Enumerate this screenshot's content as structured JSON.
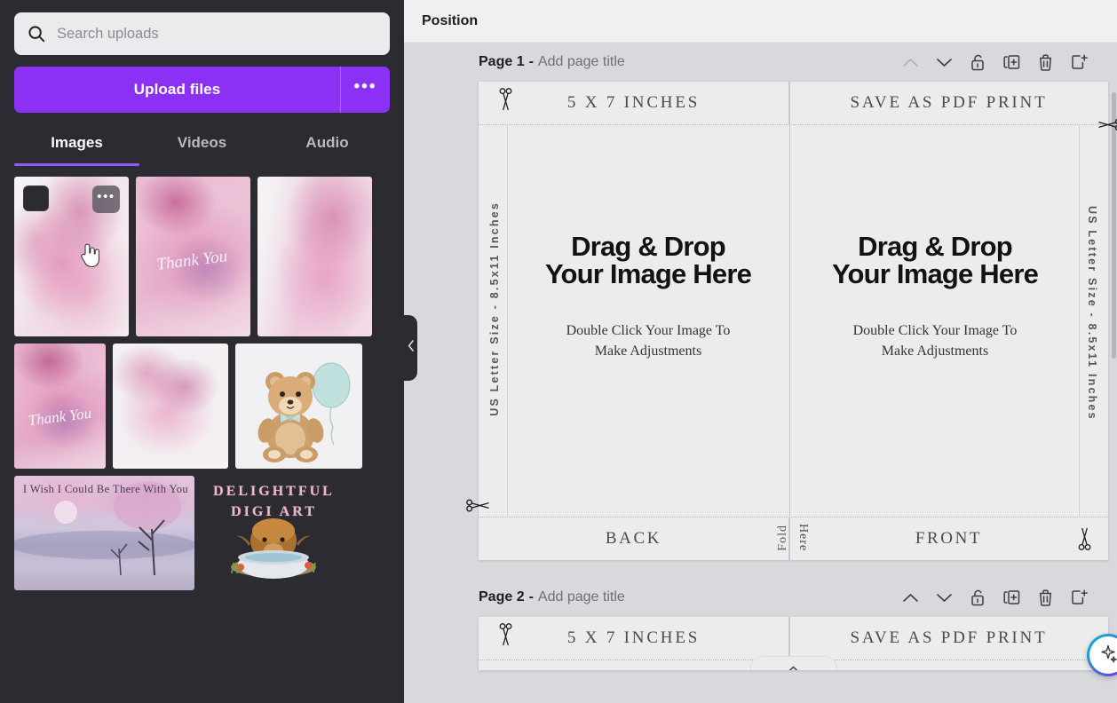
{
  "sidebar": {
    "search": {
      "placeholder": "Search uploads",
      "value": "",
      "icon": "search-icon"
    },
    "upload_button": "Upload files",
    "upload_more": "•••",
    "tabs": [
      {
        "label": "Images",
        "active": true
      },
      {
        "label": "Videos",
        "active": false
      },
      {
        "label": "Audio",
        "active": false
      }
    ],
    "thumbnails": [
      {
        "name": "pink-watercolor-blank-1",
        "selected_overlay": true,
        "menu": "•••"
      },
      {
        "name": "pink-watercolor-thank-you-1",
        "caption": "Thank You"
      },
      {
        "name": "pink-watercolor-blank-2"
      },
      {
        "name": "pink-watercolor-thank-you-2",
        "caption": "Thank You"
      },
      {
        "name": "pink-watercolor-blob"
      },
      {
        "name": "teddy-bear-balloon"
      },
      {
        "name": "wish-i-could-be-there",
        "caption": "I Wish I Could Be There With You"
      },
      {
        "name": "delightful-digi-art-logo",
        "caption": "DELIGHTFUL DIGI ART"
      }
    ],
    "collapse_icon": "chevron-left-icon"
  },
  "topbar": {
    "title": "Position"
  },
  "pages": [
    {
      "label": "Page 1",
      "separator": "-",
      "title_placeholder": "Add page title",
      "tools": [
        {
          "name": "move-page-up",
          "icon": "chevron-up-icon",
          "disabled": true
        },
        {
          "name": "move-page-down",
          "icon": "chevron-down-icon",
          "disabled": false
        },
        {
          "name": "lock-page",
          "icon": "unlock-icon",
          "disabled": false
        },
        {
          "name": "duplicate-page",
          "icon": "duplicate-icon",
          "disabled": false
        },
        {
          "name": "delete-page",
          "icon": "trash-icon",
          "disabled": false
        },
        {
          "name": "add-page",
          "icon": "add-page-icon",
          "disabled": false
        }
      ],
      "card": {
        "top_left_text": "5 X 7 INCHES",
        "top_right_text": "SAVE AS PDF PRINT",
        "left_ruler": "US Letter Size - 8.5x11 Inches",
        "right_ruler": "US Letter Size - 8.5x11 Inches",
        "back_panel": {
          "headline_line1": "Drag & Drop",
          "headline_line2": "Your Image Here",
          "sub_line1": "Double Click Your Image To",
          "sub_line2": "Make Adjustments",
          "footer": "BACK"
        },
        "front_panel": {
          "headline_line1": "Drag & Drop",
          "headline_line2": "Your Image Here",
          "sub_line1": "Double Click Your Image To",
          "sub_line2": "Make Adjustments",
          "footer": "FRONT"
        },
        "fold_left": "Fold",
        "fold_right": "Here"
      }
    },
    {
      "label": "Page 2",
      "separator": "-",
      "title_placeholder": "Add page title",
      "tools": [
        {
          "name": "move-page-up",
          "icon": "chevron-up-icon",
          "disabled": false
        },
        {
          "name": "move-page-down",
          "icon": "chevron-down-icon",
          "disabled": false
        },
        {
          "name": "lock-page",
          "icon": "unlock-icon",
          "disabled": false
        },
        {
          "name": "duplicate-page",
          "icon": "duplicate-icon",
          "disabled": false
        },
        {
          "name": "delete-page",
          "icon": "trash-icon",
          "disabled": false
        },
        {
          "name": "add-page",
          "icon": "add-page-icon",
          "disabled": false
        }
      ],
      "card": {
        "top_left_text": "5 X 7 INCHES",
        "top_right_text": "SAVE AS PDF PRINT"
      }
    }
  ],
  "floating": {
    "pill_icon": "chevron-up-icon",
    "magic_button_icon": "magic-sparkle-icon"
  },
  "colors": {
    "sidebar_bg": "#2b2b31",
    "accent_purple": "#8b30f5",
    "tab_underline": "#8b5cf6",
    "canvas_bg": "#d8d9dd",
    "sheet_bg": "#edeced",
    "topbar_bg": "#f0f0f2"
  }
}
